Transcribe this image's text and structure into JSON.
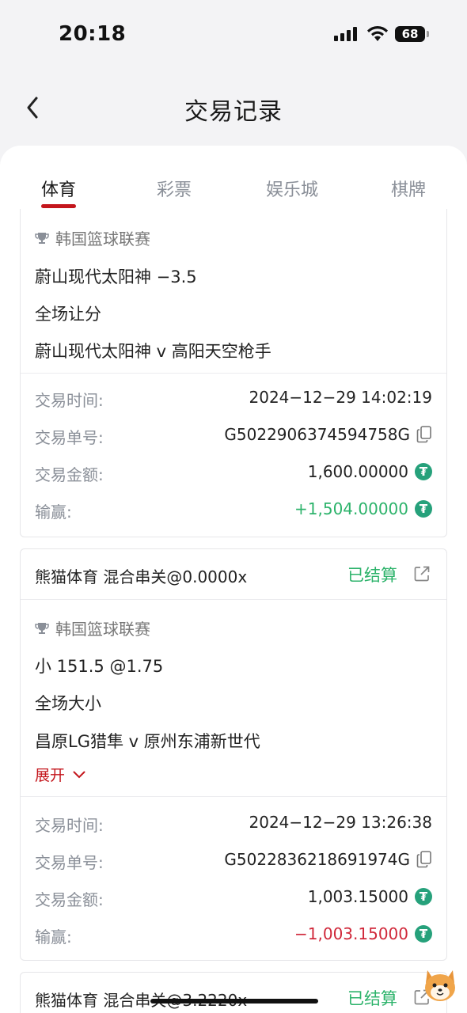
{
  "status_bar": {
    "time": "20:18",
    "battery": "68"
  },
  "header": {
    "title": "交易记录"
  },
  "tabs": [
    "体育",
    "彩票",
    "娱乐城",
    "棋牌"
  ],
  "colors": {
    "accent": "#c4161c",
    "win": "#2db36b",
    "loss": "#d0283a",
    "tether": "#26a17b"
  },
  "labels": {
    "time": "交易时间:",
    "order": "交易单号:",
    "amount": "交易金额:",
    "winloss": "输赢:",
    "expand": "展开"
  },
  "cards": [
    {
      "league": "韩国篮球联赛",
      "selection": "蔚山现代太阳神   −3.5",
      "market": "全场让分",
      "match": "蔚山现代太阳神 v 高阳天空枪手",
      "time": "2024−12−29 14:02:19",
      "order": "G5022906374594758G",
      "amount": "1,600.00000",
      "winloss": "+1,504.00000"
    },
    {
      "provider": "熊猫体育  混合串关@0.0000x",
      "status": "已结算",
      "league": "韩国篮球联赛",
      "selection": "小 151.5 @1.75",
      "market": "全场大小",
      "match": "昌原LG猎隼 v 原州东浦新世代",
      "time": "2024−12−29 13:26:38",
      "order": "G5022836218691974G",
      "amount": "1,003.15000",
      "winloss": "−1,003.15000"
    },
    {
      "provider": "熊猫体育  混合串关@3.2220x",
      "status": "已结算"
    }
  ],
  "icons": {
    "back": "chevron-left-icon",
    "trophy": "trophy-icon",
    "copy": "copy-icon",
    "external": "external-link-icon",
    "coin": "tether-icon",
    "expand": "chevron-down-icon"
  }
}
